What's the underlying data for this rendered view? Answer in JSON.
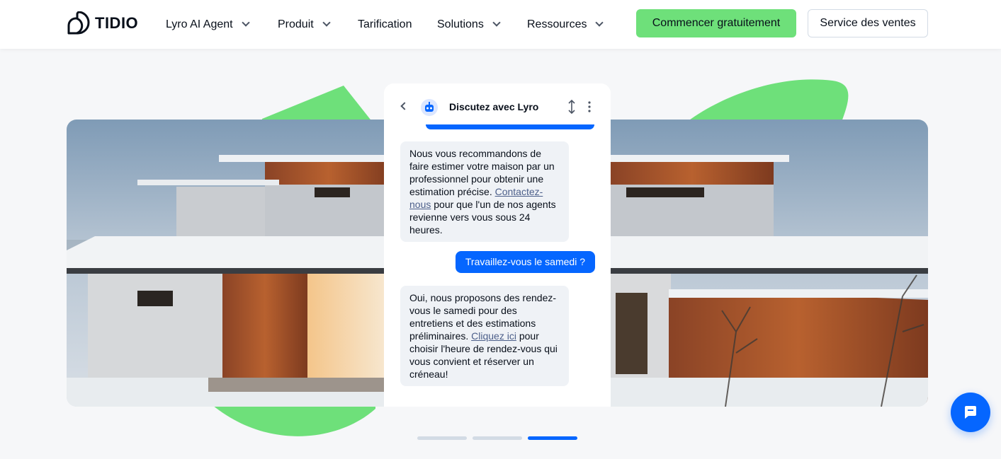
{
  "header": {
    "logo_text": "TIDIO",
    "nav": [
      {
        "label": "Lyro AI Agent",
        "has_dropdown": true
      },
      {
        "label": "Produit",
        "has_dropdown": true
      },
      {
        "label": "Tarification",
        "has_dropdown": false
      },
      {
        "label": "Solutions",
        "has_dropdown": true
      },
      {
        "label": "Ressources",
        "has_dropdown": true
      }
    ],
    "cta_primary": "Commencer gratuitement",
    "cta_secondary": "Service des ventes"
  },
  "chat": {
    "title": "Discutez avec Lyro",
    "messages": [
      {
        "role": "bot",
        "text_before": "Nous vous recommandons de faire estimer votre maison par un professionnel pour obtenir une estimation précise.",
        "link": "Contactez-nous",
        "text_after": "pour que l'un de nos agents revienne vers vous sous 24 heures."
      },
      {
        "role": "user",
        "text": "Travaillez-vous le samedi ?"
      },
      {
        "role": "bot",
        "text_before": "Oui, nous proposons des rendez-vous le samedi pour des entretiens et des estimations préliminaires.",
        "link": "Cliquez ici",
        "text_after": "pour choisir l'heure de rendez-vous qui vous convient et réserver un créneau!"
      }
    ]
  },
  "carousel": {
    "slide_count": 3,
    "active_index": 2
  },
  "colors": {
    "accent_blue": "#0566ff",
    "accent_green": "#6ee07a",
    "text": "#080f1a"
  },
  "icons": {
    "logo": "tidio-logo-icon",
    "back": "chevron-left-icon",
    "bot": "bot-avatar-icon",
    "resize": "resize-vertical-icon",
    "more": "more-vertical-icon",
    "chat_fab": "chat-bubble-icon"
  }
}
